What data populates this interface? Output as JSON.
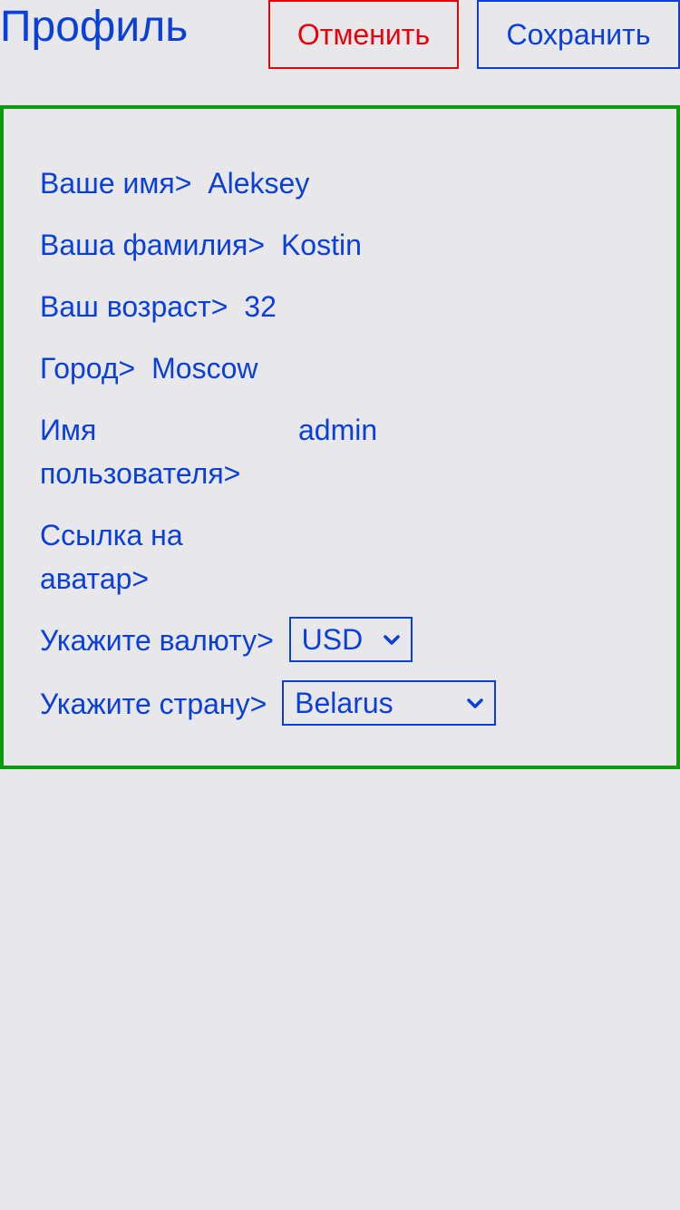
{
  "header": {
    "title": "Профиль",
    "cancel_label": "Отменить",
    "save_label": "Сохранить"
  },
  "form": {
    "first_name": {
      "label": "Ваше имя>",
      "value": "Aleksey"
    },
    "last_name": {
      "label": "Ваша фамилия>",
      "value": "Kostin"
    },
    "age": {
      "label": "Ваш возраст>",
      "value": "32"
    },
    "city": {
      "label": "Город>",
      "value": "Moscow"
    },
    "username": {
      "label_line1": "Имя",
      "label_line2": "пользователя>",
      "value": "admin"
    },
    "avatar": {
      "label_line1": "Ссылка на",
      "label_line2": "аватар>",
      "value": ""
    },
    "currency": {
      "label": "Укажите валюту>",
      "selected": "USD"
    },
    "country": {
      "label": "Укажите страну>",
      "selected": "Belarus"
    }
  },
  "colors": {
    "accent": "#0a3fdc",
    "cancel": "#e8000c",
    "panel_border": "#0a9a10",
    "background": "#e8e8ea"
  },
  "icons": {
    "select_arrow": "chevron-down-icon"
  }
}
